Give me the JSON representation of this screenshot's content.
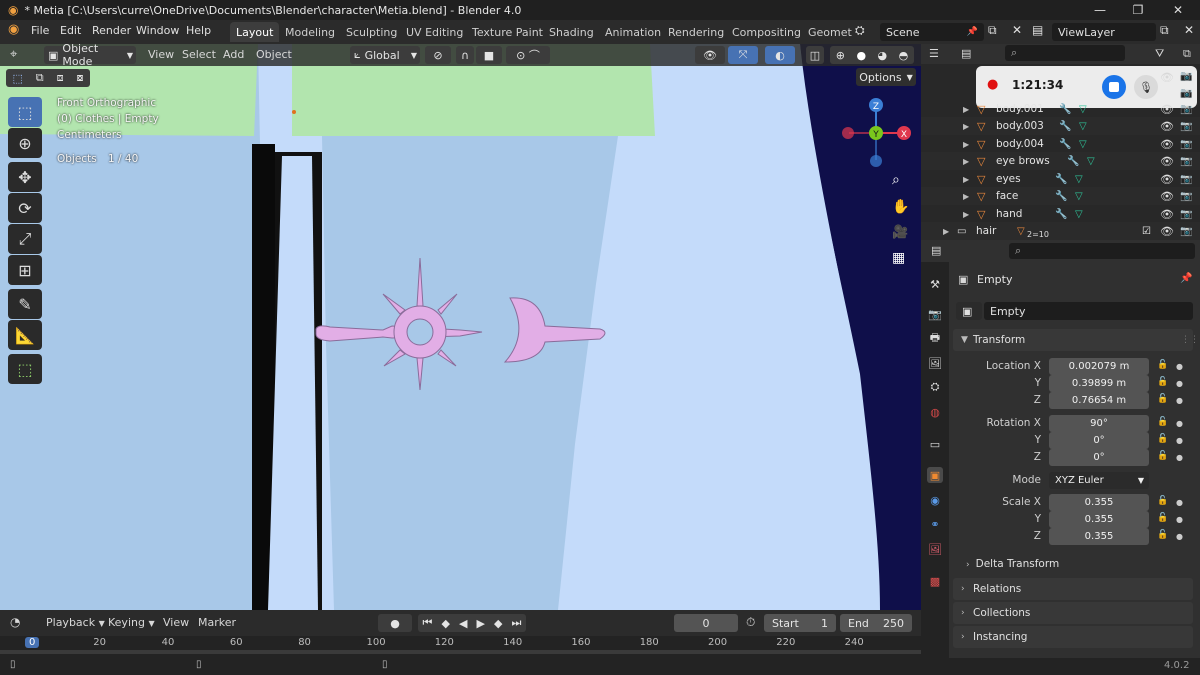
{
  "window": {
    "title": "* Metia [C:\\Users\\curre\\OneDrive\\Documents\\Blender\\character\\Metia.blend] - Blender 4.0",
    "controls": [
      "—",
      "❐",
      "✕"
    ]
  },
  "menu": [
    "File",
    "Edit",
    "Render",
    "Window",
    "Help"
  ],
  "workspaces": [
    "Layout",
    "Modeling",
    "Sculpting",
    "UV Editing",
    "Texture Paint",
    "Shading",
    "Animation",
    "Rendering",
    "Compositing",
    "Geomet"
  ],
  "scene_field": "Scene",
  "viewlayer_field": "ViewLayer",
  "viewport_header": {
    "mode": "Object Mode",
    "items": [
      "View",
      "Select",
      "Add",
      "Object"
    ],
    "transform_orientation": "Global",
    "options_label": "Options"
  },
  "viewport_overlay": {
    "view_name": "Front Orthographic",
    "collection_info": "(0) Clothes | Empty",
    "units": "Centimeters",
    "objects_label": "Objects",
    "objects_count": "1 / 40"
  },
  "gizmo": {
    "z": "Z",
    "y": "Y",
    "x": "X"
  },
  "outliner": {
    "recording_time": "1:21:34",
    "rows": [
      {
        "name": "body.001"
      },
      {
        "name": "body.003"
      },
      {
        "name": "body.004"
      },
      {
        "name": "eye brows"
      },
      {
        "name": "eyes"
      },
      {
        "name": "face"
      },
      {
        "name": "hand"
      }
    ],
    "collection_row": {
      "name": "hair",
      "count": "2",
      "count_suffix": "10"
    }
  },
  "properties": {
    "object_name": "Empty",
    "datablock_name": "Empty",
    "transform_label": "Transform",
    "location": {
      "label": "Location X",
      "x": "0.002079 m",
      "y": "0.39899 m",
      "z": "0.76654 m"
    },
    "rotation": {
      "label": "Rotation X",
      "x": "90°",
      "y": "0°",
      "z": "0°"
    },
    "mode": {
      "label": "Mode",
      "value": "XYZ Euler"
    },
    "scale": {
      "label": "Scale X",
      "x": "0.355",
      "y": "0.355",
      "z": "0.355"
    },
    "axis_y": "Y",
    "axis_z": "Z",
    "delta_transform": "Delta Transform",
    "relations": "Relations",
    "collections": "Collections",
    "instancing": "Instancing"
  },
  "timeline": {
    "menu": [
      "Playback",
      "Keying",
      "View",
      "Marker"
    ],
    "current_frame": "0",
    "start_label": "Start",
    "start_value": "1",
    "end_label": "End",
    "end_value": "250",
    "ruler": [
      "0",
      "20",
      "40",
      "60",
      "80",
      "100",
      "120",
      "140",
      "160",
      "180",
      "200",
      "220",
      "240"
    ]
  },
  "status": {
    "version": "4.0.2"
  },
  "colors": {
    "viewport_bg": "#c4dbfa",
    "mesh_light_blue": "#a8c8e8",
    "mesh_green": "#b2e5ae",
    "emblem": "#e2aee6",
    "accent_blue": "#4772b3",
    "gizmo_x": "#e0384e",
    "gizmo_y": "#7ac81d",
    "gizmo_z": "#3b7fd6"
  }
}
